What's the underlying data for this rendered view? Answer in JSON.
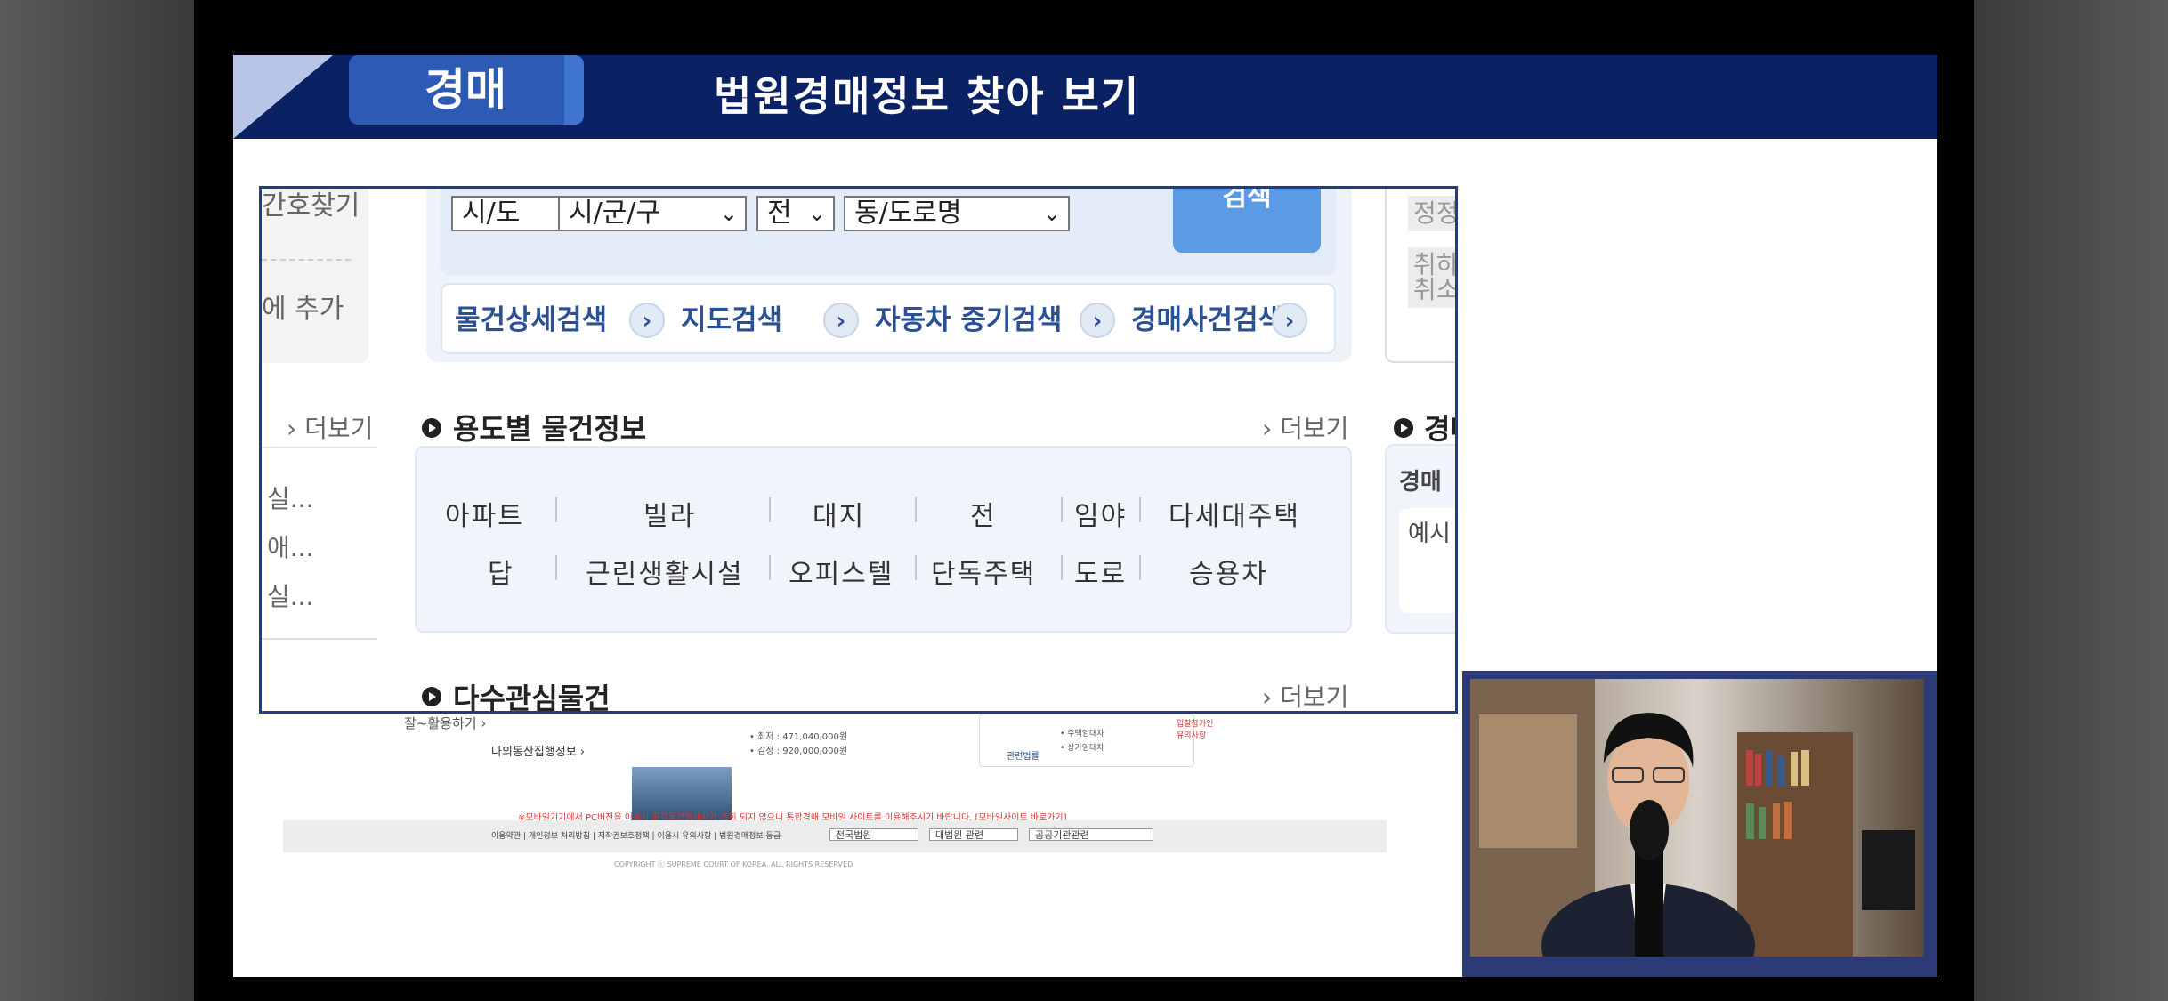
{
  "header": {
    "tag": "경매",
    "title": "법원경매정보  찾아 보기"
  },
  "left_panel": {
    "item1": "간호찾기",
    "item2": "에 추가",
    "more": "› 더보기",
    "list": [
      "실...",
      "애...",
      "실..."
    ]
  },
  "search": {
    "selects": [
      {
        "label": "시/도"
      },
      {
        "label": "시/군/구"
      },
      {
        "label": "전"
      },
      {
        "label": "동/도로명"
      }
    ],
    "button": "검색",
    "links": [
      "물건상세검색",
      "지도검색",
      "자동차 중기검색",
      "경매사건검색"
    ]
  },
  "category_section": {
    "title": "용도별 물건정보",
    "more": "› 더보기",
    "row1": [
      "아파트",
      "빌라",
      "대지",
      "전",
      "임야",
      "다세대주택"
    ],
    "row2": [
      "답",
      "근린생활시설",
      "오피스텔",
      "단독주택",
      "도로",
      "승용차"
    ]
  },
  "popular_section": {
    "title": "다수관심물건",
    "more": "› 더보기"
  },
  "right_panel": {
    "chip1": "정정",
    "chip2a": "취하",
    "chip2b": "취소",
    "section_title": "경매",
    "box_title": "경매",
    "box_text": "예시"
  },
  "footer": {
    "link1": "잘~활용하기 ›",
    "link2": "나의동산집행정보 ›",
    "price1": "• 최저 : 471,040,000원",
    "price2": "• 감정 : 920,000,000원",
    "law_items": [
      "• 주택임대차",
      "• 상가임대차"
    ],
    "law_label": "관련법률",
    "badge": "입찰참가인 유의사항",
    "notice": "※모바일기기에서 PC버전을 이용시 화각물건명세서가 조회 되지 않으니 통합경매 모바일 사이트를 이용해주시기 바랍니다. [모바일사이트 바로가기]",
    "bar_text": "이용약관 | 개인정보 처리방침 | 저작권보호정책 | 이용시 유의사항 | 법원경매정보 등급",
    "selects": [
      "전국법원",
      "대법원 관련",
      "공공기관관련"
    ],
    "copyright": "COPYRIGHT ⓒ SUPREME COURT OF KOREA. ALL RIGHTS RESERVED"
  }
}
